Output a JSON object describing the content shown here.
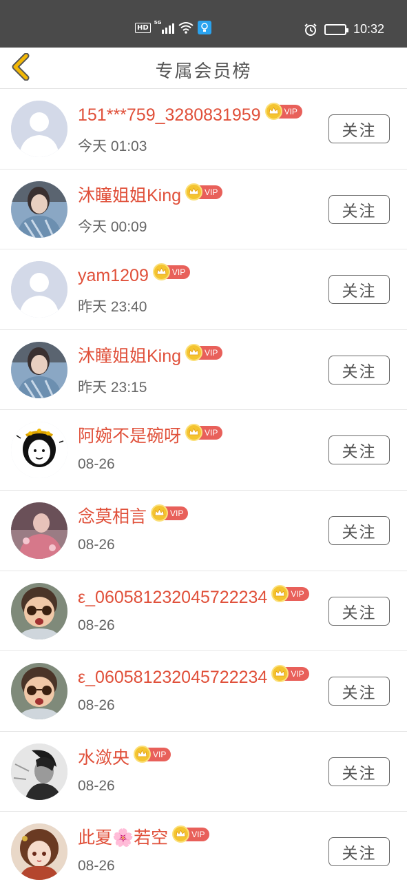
{
  "status_bar": {
    "hd": "HD",
    "network": "5G",
    "time": "10:32",
    "icons": [
      "hd-icon",
      "signal-icon",
      "wifi-icon",
      "lightbulb-app-icon",
      "alarm-icon",
      "battery-icon"
    ]
  },
  "header": {
    "title": "专属会员榜",
    "back_icon": "chevron-left-icon",
    "back_color": "#f2b705"
  },
  "colors": {
    "name": "#e0503a",
    "vip_badge": "#e8605a",
    "crown": "#f4c430",
    "time": "#666666"
  },
  "members": [
    {
      "name": "151***759_3280831959",
      "badge": "VIP",
      "time": "今天 01:03",
      "follow_label": "关注",
      "avatar": "default"
    },
    {
      "name": "沐瞳姐姐King",
      "badge": "VIP",
      "time": "今天 00:09",
      "follow_label": "关注",
      "avatar": "girl-photo"
    },
    {
      "name": "yam1209",
      "badge": "VIP",
      "time": "昨天 23:40",
      "follow_label": "关注",
      "avatar": "default"
    },
    {
      "name": "沐瞳姐姐King",
      "badge": "VIP",
      "time": "昨天 23:15",
      "follow_label": "关注",
      "avatar": "girl-photo"
    },
    {
      "name": "阿婉不是碗呀",
      "badge": "VIP",
      "time": "08-26",
      "follow_label": "关注",
      "avatar": "cartoon"
    },
    {
      "name": "念莫相言",
      "badge": "VIP",
      "time": "08-26",
      "follow_label": "关注",
      "avatar": "pink-photo"
    },
    {
      "name": "ε_060581232045722234",
      "badge": "VIP",
      "time": "08-26",
      "follow_label": "关注",
      "avatar": "kid-sunglasses"
    },
    {
      "name": "ε_060581232045722234",
      "badge": "VIP",
      "time": "08-26",
      "follow_label": "关注",
      "avatar": "kid-sunglasses"
    },
    {
      "name": "水潋央",
      "badge": "VIP",
      "time": "08-26",
      "follow_label": "关注",
      "avatar": "bw-portrait"
    },
    {
      "name": "此夏🌸若空",
      "badge": "VIP",
      "time": "08-26",
      "follow_label": "关注",
      "avatar": "anime-girl"
    }
  ]
}
